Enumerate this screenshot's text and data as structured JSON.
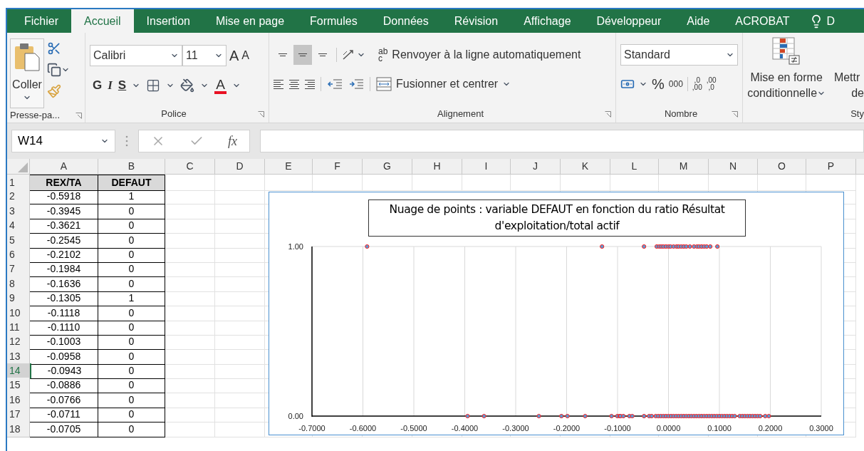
{
  "tabs": [
    {
      "label": "Fichier",
      "selected": false
    },
    {
      "label": "Accueil",
      "selected": true
    },
    {
      "label": "Insertion",
      "selected": false
    },
    {
      "label": "Mise en page",
      "selected": false
    },
    {
      "label": "Formules",
      "selected": false
    },
    {
      "label": "Données",
      "selected": false
    },
    {
      "label": "Révision",
      "selected": false
    },
    {
      "label": "Affichage",
      "selected": false
    },
    {
      "label": "Développeur",
      "selected": false
    },
    {
      "label": "Aide",
      "selected": false
    },
    {
      "label": "ACROBAT",
      "selected": false
    }
  ],
  "tell_me": "D",
  "ribbon": {
    "clipboard": {
      "paste": "Coller",
      "label": "Presse-pa..."
    },
    "font": {
      "name": "Calibri",
      "size": "11",
      "grow": "A",
      "shrink": "A",
      "bold": "G",
      "italic": "I",
      "underline": "S",
      "color_letter": "A",
      "label": "Police"
    },
    "alignment": {
      "vertical": [
        {
          "selected": false
        },
        {
          "selected": true
        },
        {
          "selected": false
        }
      ],
      "wrap_icon_top": "ab",
      "wrap_icon_bottom": "c",
      "wrap": "Renvoyer à la ligne automatiquement",
      "merge": "Fusionner et centrer",
      "label": "Alignement"
    },
    "number": {
      "format": "Standard",
      "percent": "%",
      "thousands": "000",
      "increase_top": ",0",
      "increase_bottom": ",00",
      "decrease_top": ",00",
      "decrease_bottom": ",0",
      "label": "Nombre"
    },
    "styles": {
      "conditional_line1": "Mise en forme",
      "conditional_line2": "conditionnelle",
      "table_line1": "Mettr",
      "table_line2": "de",
      "label": "Sty"
    }
  },
  "formula_bar": {
    "name_box": "W14",
    "fx": "fx"
  },
  "sheet": {
    "columns": [
      "A",
      "B",
      "C",
      "D",
      "E",
      "F",
      "G",
      "H",
      "I",
      "J",
      "K",
      "L",
      "M",
      "N",
      "O",
      "P"
    ],
    "rows": [
      {
        "number": "1",
        "selected": false,
        "kind": "header",
        "a": "REX/TA",
        "b": "DEFAUT"
      },
      {
        "number": "2",
        "selected": false,
        "kind": "data",
        "a": "-0.5918",
        "b": "1"
      },
      {
        "number": "3",
        "selected": false,
        "kind": "data",
        "a": "-0.3945",
        "b": "0"
      },
      {
        "number": "4",
        "selected": false,
        "kind": "data",
        "a": "-0.3621",
        "b": "0"
      },
      {
        "number": "5",
        "selected": false,
        "kind": "data",
        "a": "-0.2545",
        "b": "0"
      },
      {
        "number": "6",
        "selected": false,
        "kind": "data",
        "a": "-0.2102",
        "b": "0"
      },
      {
        "number": "7",
        "selected": false,
        "kind": "data",
        "a": "-0.1984",
        "b": "0"
      },
      {
        "number": "8",
        "selected": false,
        "kind": "data",
        "a": "-0.1636",
        "b": "0"
      },
      {
        "number": "9",
        "selected": false,
        "kind": "data",
        "a": "-0.1305",
        "b": "1"
      },
      {
        "number": "10",
        "selected": false,
        "kind": "data",
        "a": "-0.1118",
        "b": "0"
      },
      {
        "number": "11",
        "selected": false,
        "kind": "data",
        "a": "-0.1110",
        "b": "0"
      },
      {
        "number": "12",
        "selected": false,
        "kind": "data",
        "a": "-0.1003",
        "b": "0"
      },
      {
        "number": "13",
        "selected": false,
        "kind": "data",
        "a": "-0.0958",
        "b": "0"
      },
      {
        "number": "14",
        "selected": true,
        "kind": "data",
        "a": "-0.0943",
        "b": "0"
      },
      {
        "number": "15",
        "selected": false,
        "kind": "data",
        "a": "-0.0886",
        "b": "0"
      },
      {
        "number": "16",
        "selected": false,
        "kind": "data",
        "a": "-0.0766",
        "b": "0"
      },
      {
        "number": "17",
        "selected": false,
        "kind": "data",
        "a": "-0.0711",
        "b": "0"
      },
      {
        "number": "18",
        "selected": false,
        "kind": "data",
        "a": "-0.0705",
        "b": "0"
      }
    ]
  },
  "chart": {
    "chart_data": {
      "type": "scatter",
      "title": "Nuage de points : variable DEFAUT en fonction du ratio Résultat d'exploitation/total actif",
      "x": [
        -0.5918,
        -0.1305,
        -0.048,
        -0.023,
        -0.018,
        -0.014,
        -0.01,
        -0.005,
        0.0,
        0.004,
        0.01,
        0.016,
        0.02,
        0.025,
        0.03,
        0.035,
        0.042,
        0.05,
        0.056,
        0.06,
        0.065,
        0.07,
        0.075,
        0.082,
        0.096,
        -0.3945,
        -0.3621,
        -0.2545,
        -0.2102,
        -0.1984,
        -0.1636,
        -0.1118,
        -0.1003,
        -0.0958,
        -0.0943,
        -0.0886,
        -0.0766,
        -0.0711,
        -0.048,
        -0.038,
        -0.033,
        -0.025,
        -0.02,
        -0.015,
        -0.01,
        -0.005,
        0.0,
        0.005,
        0.01,
        0.015,
        0.02,
        0.025,
        0.03,
        0.035,
        0.04,
        0.045,
        0.05,
        0.055,
        0.06,
        0.065,
        0.07,
        0.075,
        0.08,
        0.085,
        0.09,
        0.095,
        0.1,
        0.105,
        0.11,
        0.115,
        0.12,
        0.125,
        0.13,
        0.14,
        0.145,
        0.15,
        0.155,
        0.16,
        0.165,
        0.17,
        0.175,
        0.18,
        0.19,
        0.197
      ],
      "series": [
        {
          "color": "#ff2020",
          "values": [
            1,
            1,
            1,
            1,
            1,
            1,
            1,
            1,
            1,
            1,
            1,
            1,
            1,
            1,
            1,
            1,
            1,
            1,
            1,
            1,
            1,
            1,
            1,
            1,
            1,
            0,
            0,
            0,
            0,
            0,
            0,
            0,
            0,
            0,
            0,
            0,
            0,
            0,
            0,
            0,
            0,
            0,
            0,
            0,
            0,
            0,
            0,
            0,
            0,
            0,
            0,
            0,
            0,
            0,
            0,
            0,
            0,
            0,
            0,
            0,
            0,
            0,
            0,
            0,
            0,
            0,
            0,
            0,
            0,
            0,
            0,
            0,
            0,
            0,
            0,
            0,
            0,
            0,
            0,
            0,
            0,
            0,
            0,
            0
          ]
        }
      ],
      "xlim": [
        -0.7,
        0.3
      ],
      "ylim": [
        0,
        1
      ],
      "grid": true,
      "xticks": [
        {
          "value": -0.7,
          "label": "-0.7000"
        },
        {
          "value": -0.6,
          "label": "-0.6000"
        },
        {
          "value": -0.5,
          "label": "-0.5000"
        },
        {
          "value": -0.4,
          "label": "-0.4000"
        },
        {
          "value": -0.3,
          "label": "-0.3000"
        },
        {
          "value": -0.2,
          "label": "-0.2000"
        },
        {
          "value": -0.1,
          "label": "-0.1000"
        },
        {
          "value": 0,
          "label": "0.0000"
        },
        {
          "value": 0.1,
          "label": "0.1000"
        },
        {
          "value": 0.2,
          "label": "0.2000"
        },
        {
          "value": 0.3,
          "label": "0.3000"
        }
      ],
      "yticks": [
        {
          "value": 0,
          "label": "0.00"
        },
        {
          "value": 1,
          "label": "1.00"
        }
      ]
    }
  }
}
